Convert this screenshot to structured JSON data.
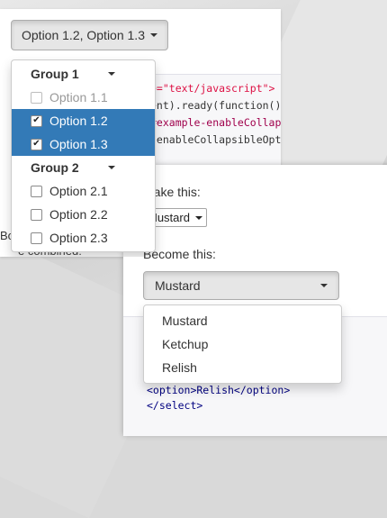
{
  "colors": {
    "selected_bg": "#337ab7",
    "code_bg": "#f7f7f9"
  },
  "demo1": {
    "button_label": "Option 1.2, Option 1.3",
    "groups": [
      {
        "label": "Group 1",
        "options": [
          {
            "label": "Option 1.1",
            "checked": false,
            "disabled": true
          },
          {
            "label": "Option 1.2",
            "checked": true,
            "disabled": false
          },
          {
            "label": "Option 1.3",
            "checked": true,
            "disabled": false
          }
        ]
      },
      {
        "label": "Group 2",
        "options": [
          {
            "label": "Option 2.1",
            "checked": false,
            "disabled": false
          },
          {
            "label": "Option 2.2",
            "checked": false,
            "disabled": false
          },
          {
            "label": "Option 2.3",
            "checked": false,
            "disabled": false
          }
        ]
      }
    ],
    "code_lines": [
      "e=\"text/javascript\">",
      "ent).ready(function()",
      "#example-enableCollap",
      " enableCollapsibleOpt"
    ],
    "behind_text_1": "Bo",
    "behind_text_2": "e combined:"
  },
  "demo2": {
    "make_label": "Make this:",
    "native_value": "Mustard",
    "become_label": "Become this:",
    "button_label": "Mustard",
    "options": [
      "Mustard",
      "Ketchup",
      "Relish"
    ],
    "code_lines": [
      "<option>Relish</option>",
      "</select>"
    ]
  },
  "icons": [
    "caret-down-icon",
    "checkbox-icon",
    "checkmark-icon"
  ]
}
